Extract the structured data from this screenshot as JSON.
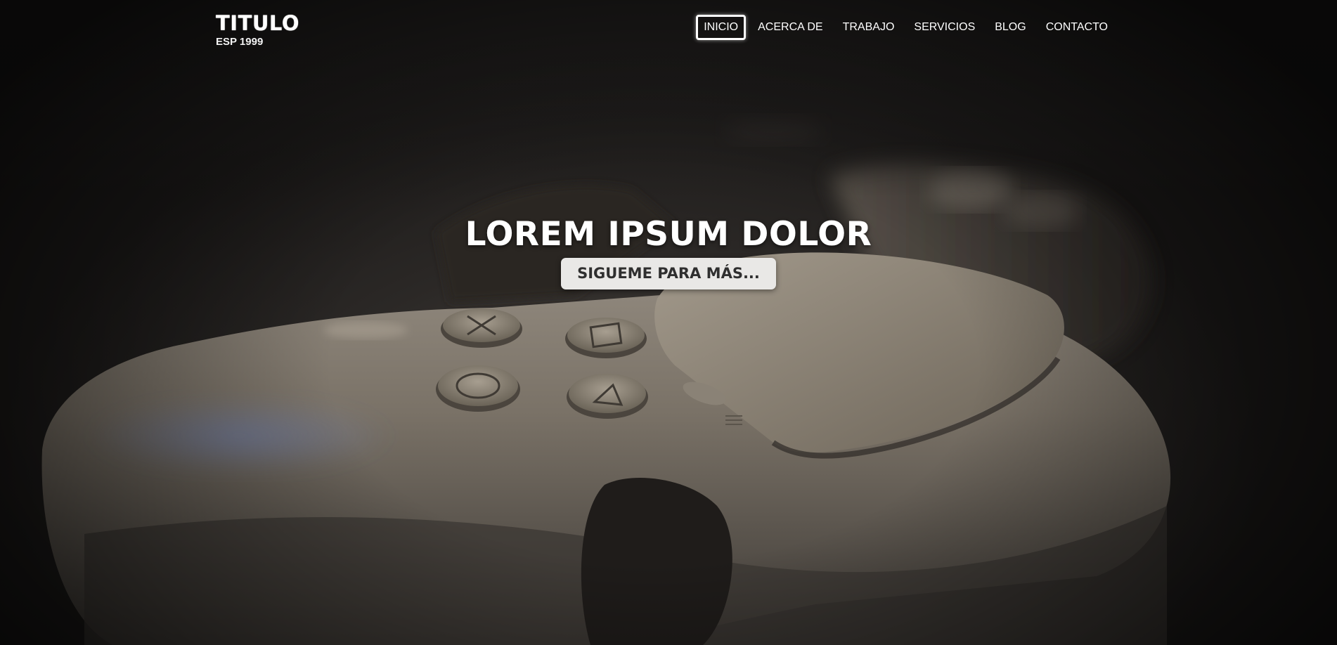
{
  "brand": {
    "title": "TITULO",
    "subtitle": "ESP 1999"
  },
  "nav": {
    "items": [
      {
        "label": "INICIO",
        "active": true
      },
      {
        "label": "ACERCA DE",
        "active": false
      },
      {
        "label": "TRABAJO",
        "active": false
      },
      {
        "label": "SERVICIOS",
        "active": false
      },
      {
        "label": "BLOG",
        "active": false
      },
      {
        "label": "CONTACTO",
        "active": false
      }
    ]
  },
  "hero": {
    "title": "LOREM IPSUM DOLOR",
    "cta_label": "SIGUEME PARA MÁS...",
    "background_image": "game-controller-photo"
  },
  "colors": {
    "text": "#ffffff",
    "button_bg": "#e9e8e6",
    "button_text": "#2f2f2f",
    "background": "#1c1a19"
  }
}
